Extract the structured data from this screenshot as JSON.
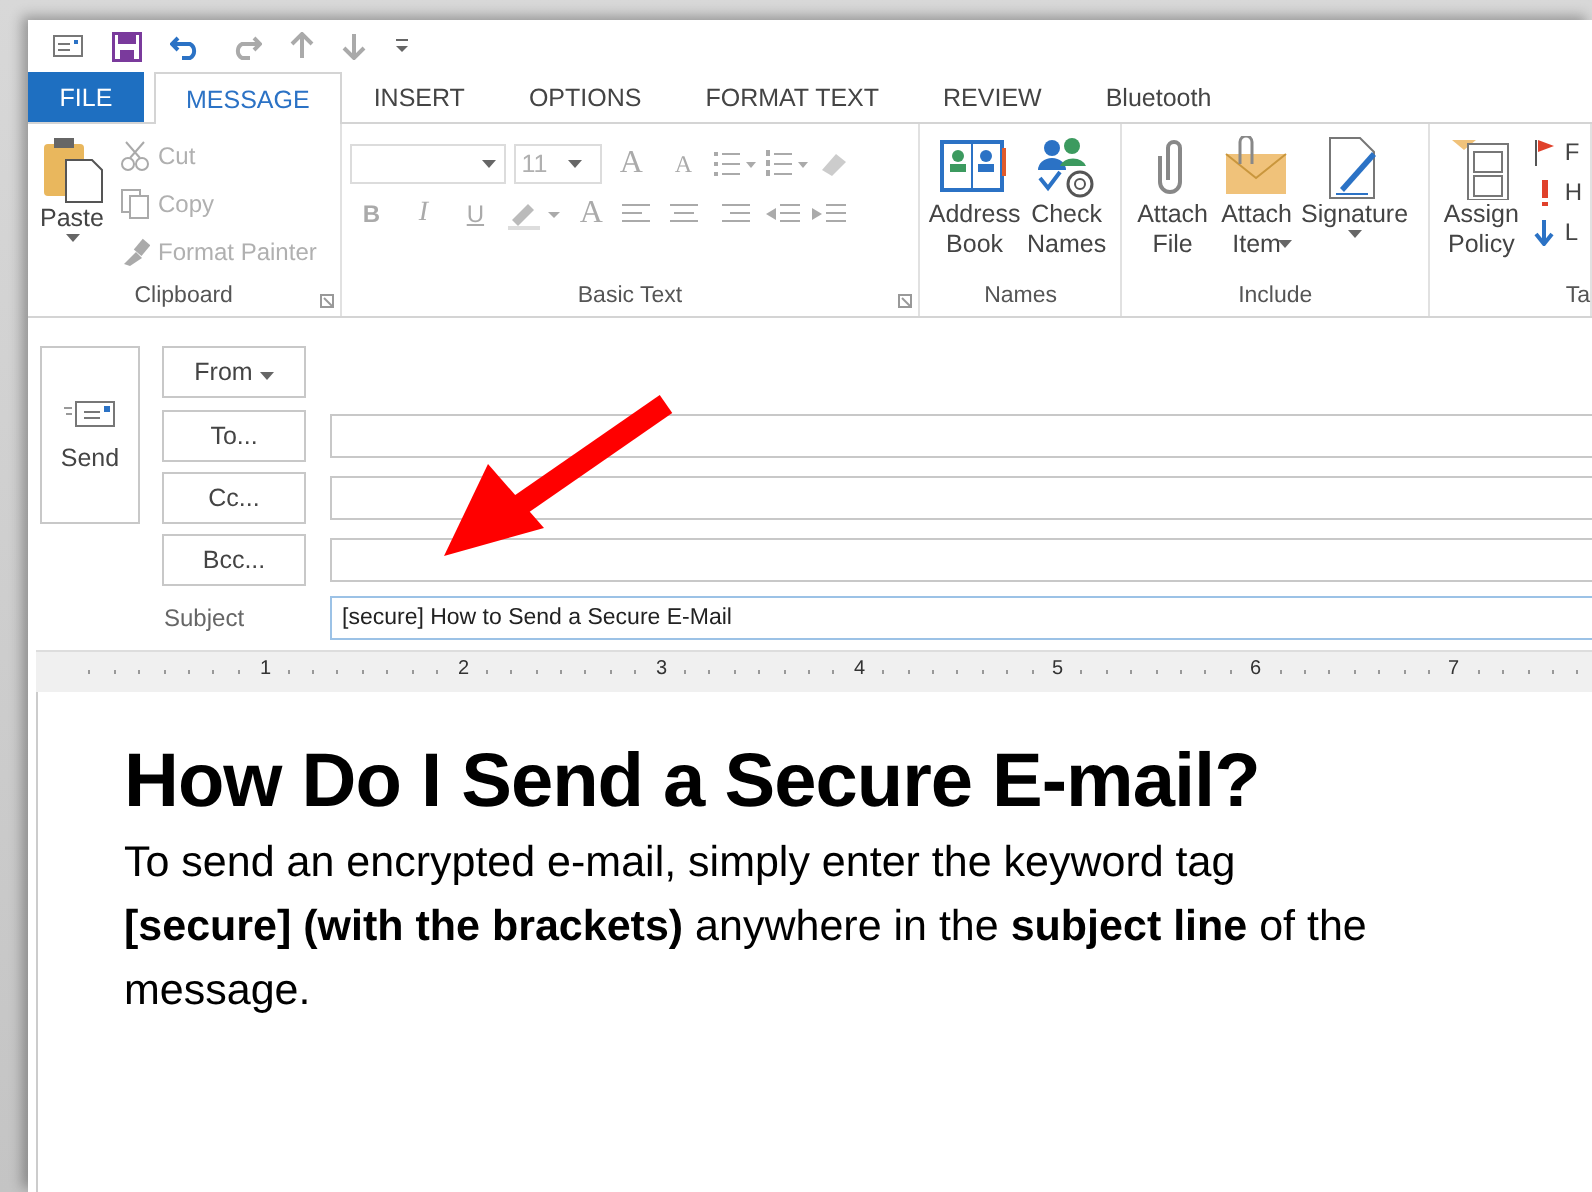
{
  "tabs": [
    {
      "label": "FILE",
      "kind": "file",
      "selected": false
    },
    {
      "label": "MESSAGE",
      "kind": "tab",
      "selected": true
    },
    {
      "label": "INSERT",
      "kind": "tab",
      "selected": false
    },
    {
      "label": "OPTIONS",
      "kind": "tab",
      "selected": false
    },
    {
      "label": "FORMAT TEXT",
      "kind": "tab",
      "selected": false
    },
    {
      "label": "REVIEW",
      "kind": "tab",
      "selected": false
    },
    {
      "label": "Bluetooth",
      "kind": "tab",
      "selected": false
    }
  ],
  "ribbon": {
    "clipboard": {
      "label": "Clipboard",
      "paste": "Paste",
      "small": [
        {
          "label": "Cut",
          "disabled": true
        },
        {
          "label": "Copy",
          "disabled": true
        },
        {
          "label": "Format Painter",
          "disabled": true
        }
      ]
    },
    "basic_text": {
      "label": "Basic Text",
      "disabled": true,
      "font_size": "11",
      "grow": "A",
      "shrink": "A",
      "bold": "B",
      "italic": "I",
      "underline": "U",
      "font_color": "A"
    },
    "names": {
      "label": "Names",
      "buttons": [
        "Address Book",
        "Check Names"
      ]
    },
    "include": {
      "label": "Include",
      "buttons": [
        {
          "label": "Attach File",
          "dropdown": false
        },
        {
          "label": "Attach Item",
          "dropdown": true
        },
        {
          "label": "Signature",
          "dropdown": true
        }
      ]
    },
    "tags": {
      "label": "Ta",
      "policy": "Assign Policy",
      "small": [
        "F",
        "H",
        "L"
      ]
    }
  },
  "header": {
    "send": "Send",
    "from": "From",
    "recipients": [
      "To...",
      "Cc...",
      "Bcc..."
    ],
    "subject_label": "Subject",
    "subject": "[secure] How to Send a Secure E-Mail"
  },
  "ruler": [
    "1",
    "2",
    "3",
    "4",
    "5",
    "6",
    "7"
  ],
  "body": {
    "heading": "How Do I Send a Secure E-mail?",
    "paragraph": "To send an encrypted e-mail, simply enter the keyword tag **[secure] (with the brackets)** anywhere in the **subject line** of the message."
  }
}
